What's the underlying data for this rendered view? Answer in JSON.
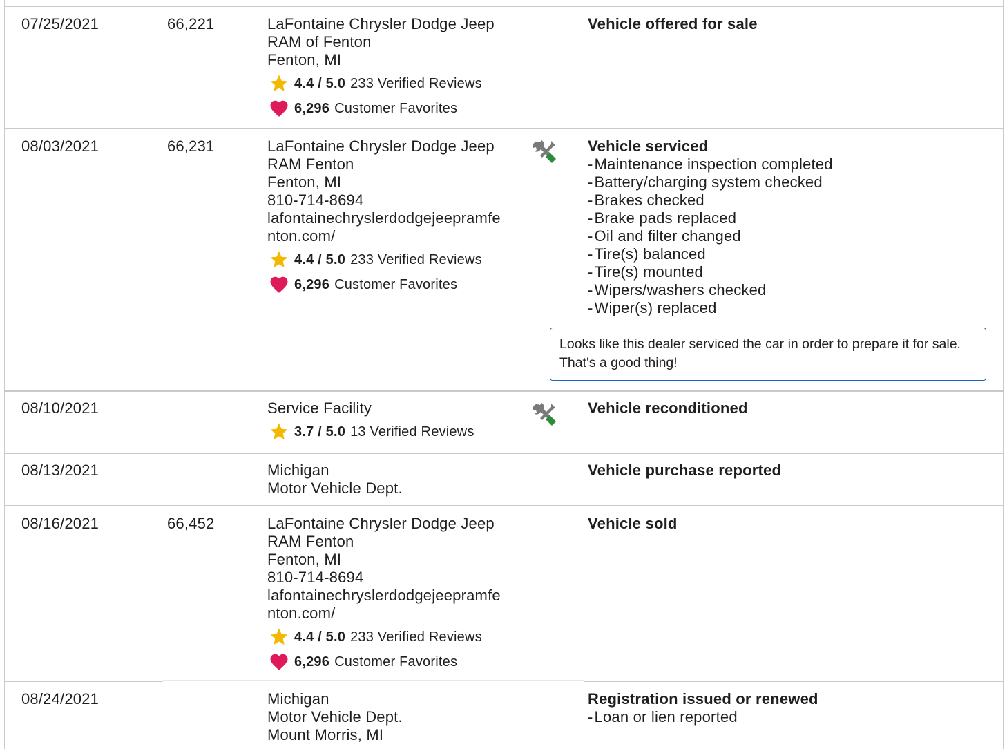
{
  "records": [
    {
      "date": "07/25/2021",
      "odometer": "66,221",
      "source_lines": [
        "LaFontaine Chrysler Dodge Jeep",
        "RAM of Fenton",
        "Fenton, MI"
      ],
      "rating": {
        "score": "4.4 / 5.0",
        "reviews": "233 Verified Reviews"
      },
      "favorites": {
        "count": "6,296",
        "label": "Customer Favorites"
      },
      "icon": null,
      "title": "Vehicle offered for sale",
      "items": []
    },
    {
      "date": "08/03/2021",
      "odometer": "66,231",
      "source_lines": [
        "LaFontaine Chrysler Dodge Jeep",
        "RAM Fenton",
        "Fenton, MI",
        "810-714-8694",
        "lafontainechryslerdodgejeepramfe",
        "nton.com/"
      ],
      "rating": {
        "score": "4.4 / 5.0",
        "reviews": "233 Verified Reviews"
      },
      "favorites": {
        "count": "6,296",
        "label": "Customer Favorites"
      },
      "icon": "service-tools-icon",
      "title": "Vehicle serviced",
      "items": [
        "Maintenance inspection completed",
        "Battery/charging system checked",
        "Brakes checked",
        "Brake pads replaced",
        "Oil and filter changed",
        "Tire(s) balanced",
        "Tire(s) mounted",
        "Wipers/washers checked",
        "Wiper(s) replaced"
      ],
      "note": "Looks like this dealer serviced the car in order to prepare it for sale. That's a good thing!"
    },
    {
      "date": "08/10/2021",
      "odometer": "",
      "source_lines": [
        "Service Facility"
      ],
      "rating": {
        "score": "3.7 / 5.0",
        "reviews": "13 Verified Reviews"
      },
      "favorites": null,
      "icon": "service-tools-icon",
      "title": "Vehicle reconditioned",
      "items": []
    },
    {
      "date": "08/13/2021",
      "odometer": "",
      "source_lines": [
        "Michigan",
        "Motor Vehicle Dept."
      ],
      "rating": null,
      "favorites": null,
      "icon": null,
      "title": "Vehicle purchase reported",
      "items": []
    },
    {
      "date": "08/16/2021",
      "odometer": "66,452",
      "source_lines": [
        "LaFontaine Chrysler Dodge Jeep",
        "RAM Fenton",
        "Fenton, MI",
        "810-714-8694",
        "lafontainechryslerdodgejeepramfe",
        "nton.com/"
      ],
      "rating": {
        "score": "4.4 / 5.0",
        "reviews": "233 Verified Reviews"
      },
      "favorites": {
        "count": "6,296",
        "label": "Customer Favorites"
      },
      "icon": null,
      "title": "Vehicle sold",
      "items": []
    },
    {
      "date": "08/24/2021",
      "odometer": "",
      "source_lines": [
        "Michigan",
        "Motor Vehicle Dept.",
        "Mount Morris, MI"
      ],
      "rating": null,
      "favorites": null,
      "icon": null,
      "title": "Registration issued or renewed",
      "items": [
        "Loan or lien reported"
      ]
    }
  ],
  "colors": {
    "star": "#f5b800",
    "heart": "#e0195a",
    "tool_green": "#2e8b3a",
    "tool_gray": "#7a7a7a",
    "callout_border": "#1e64c8"
  }
}
